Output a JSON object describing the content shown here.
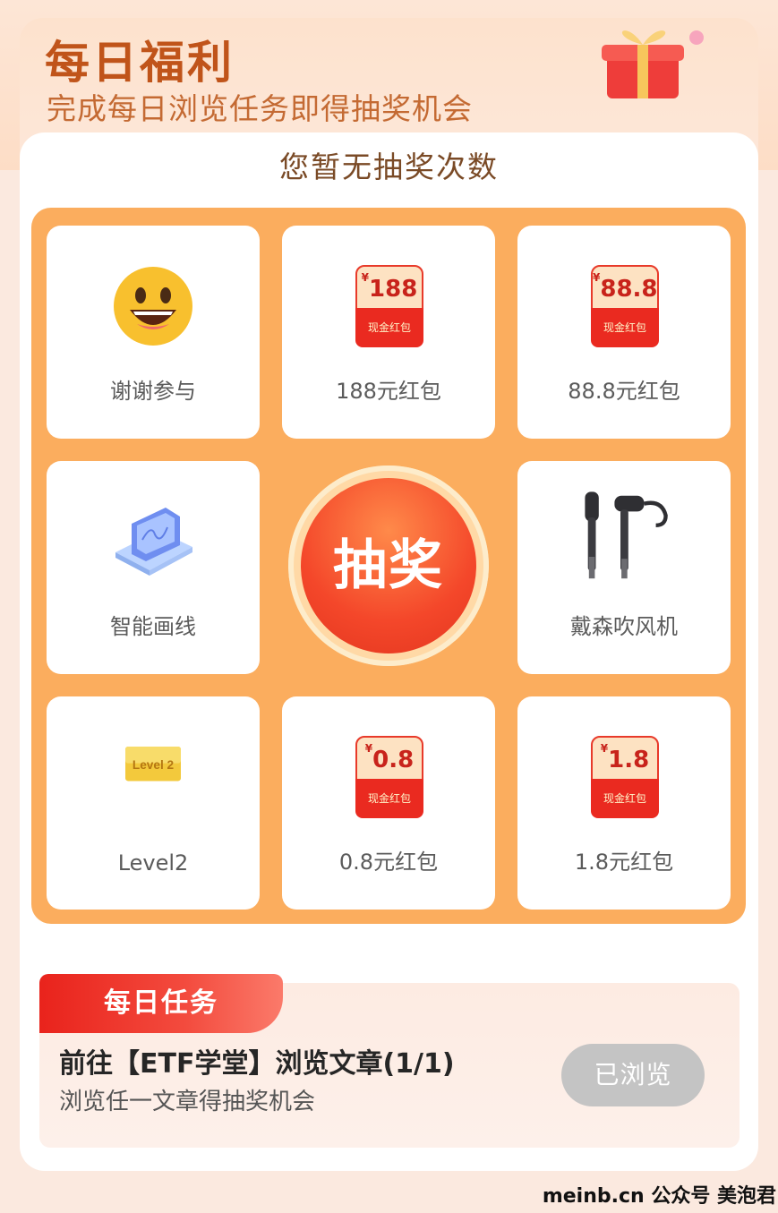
{
  "header": {
    "title": "每日福利",
    "subtitle": "完成每日浏览任务即得抽奖机会"
  },
  "lottery": {
    "chance_text": "您暂无抽奖次数",
    "draw_label": "抽奖",
    "prizes": [
      {
        "label": "谢谢参与",
        "icon": "smiley-face-icon"
      },
      {
        "label": "188元红包",
        "icon": "red-envelope-icon",
        "amount": "188",
        "tag": "现金红包"
      },
      {
        "label": "88.8元红包",
        "icon": "red-envelope-icon",
        "amount": "88.8",
        "tag": "现金红包"
      },
      {
        "label": "智能画线",
        "icon": "tablet-chart-icon"
      },
      {
        "label": "戴森吹风机",
        "icon": "hair-dryer-icon"
      },
      {
        "label": "Level2",
        "icon": "level2-card-icon",
        "card_text": "Level 2"
      },
      {
        "label": "0.8元红包",
        "icon": "red-envelope-icon",
        "amount": "0.8",
        "tag": "现金红包"
      },
      {
        "label": "1.8元红包",
        "icon": "red-envelope-icon",
        "amount": "1.8",
        "tag": "现金红包"
      }
    ],
    "currency_symbol": "¥"
  },
  "task": {
    "tag": "每日任务",
    "title": "前往【ETF学堂】浏览文章(1/1)",
    "desc": "浏览任一文章得抽奖机会",
    "button": "已浏览"
  },
  "footer": {
    "text": "meinb.cn  公众号 美泡君"
  },
  "colors": {
    "accent": "#fbad5e",
    "title": "#c0541a",
    "draw": "#f4472a",
    "red_envelope": "#ea2a20"
  }
}
